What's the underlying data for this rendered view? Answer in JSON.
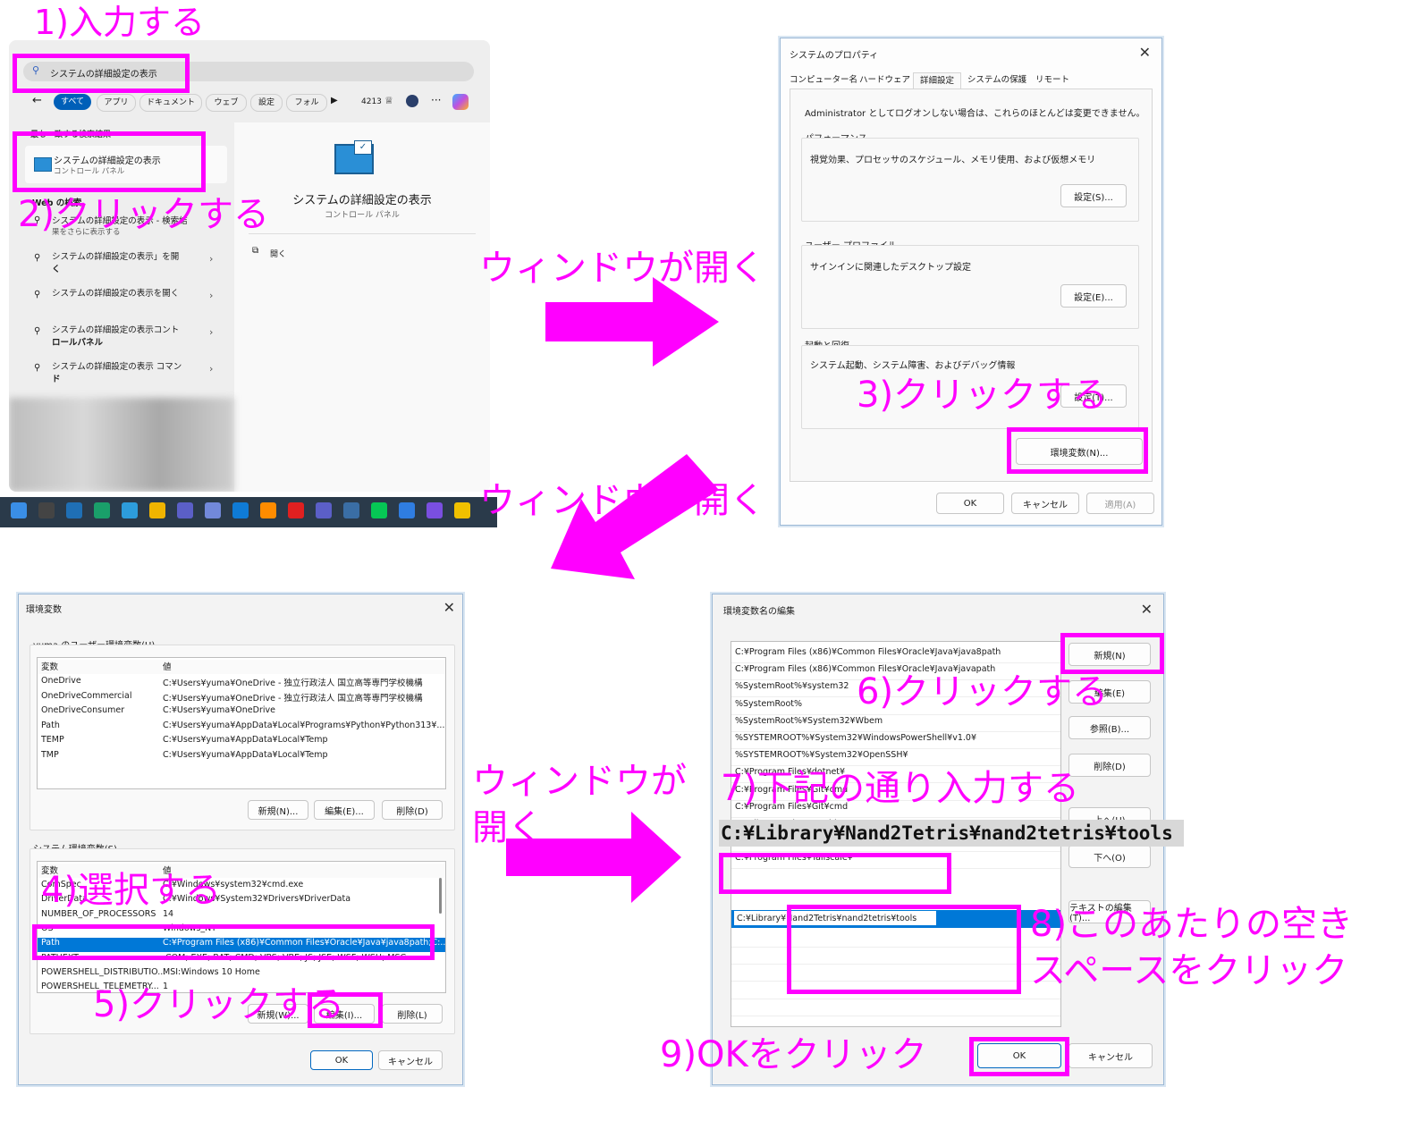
{
  "annotations": {
    "step1": "1)入力する",
    "step2": "2)クリックする",
    "step3": "3)クリックする",
    "step4": "4)選択する",
    "step5": "5)クリックする",
    "step6": "6)クリックする",
    "step7": "7)下記の通り入力する",
    "step8_line1": "8)このあたりの空き",
    "step8_line2": "スペースをクリック",
    "step9": "9)OKをクリック",
    "window_opens": "ウィンドウが開く",
    "window_opens_a": "ウィンドウが",
    "window_opens_b": "開く",
    "path_value": "C:¥Library¥Nand2Tetris¥nand2tetris¥tools"
  },
  "search_panel": {
    "query": "システムの詳細設定の表示",
    "filters": [
      "すべて",
      "アプリ",
      "ドキュメント",
      "ウェブ",
      "設定",
      "フォル"
    ],
    "points": "4213",
    "best_match_header": "最も一致する検索結果",
    "best_match_title": "システムの詳細設定の表示",
    "best_match_sub": "コントロール パネル",
    "web_header": "Web の検索",
    "web_item1": "システムの詳細設定の表示 - 検索結",
    "web_item1_sub": "果をさらに表示する",
    "web_items": [
      {
        "a": "システムの詳細設定の表示」を開",
        "b": "く"
      },
      {
        "a": "システムの詳細設定の表示を開く",
        "b": ""
      },
      {
        "a": "システムの詳細設定の表示コント",
        "b": "ロールパネル"
      },
      {
        "a": "システムの詳細設定の表示 コマン",
        "b": "ド"
      }
    ],
    "preview_title": "システムの詳細設定の表示",
    "preview_sub": "コントロール パネル",
    "open_label": "開く"
  },
  "sysprops": {
    "title": "システムのプロパティ",
    "tabs": [
      "コンピューター名",
      "ハードウェア",
      "詳細設定",
      "システムの保護",
      "リモート"
    ],
    "admin_note": "Administrator としてログオンしない場合は、これらのほとんどは変更できません。",
    "perf_title": "パフォーマンス",
    "perf_desc": "視覚効果、プロセッサのスケジュール、メモリ使用、および仮想メモリ",
    "perf_btn": "設定(S)...",
    "profile_title": "ユーザー プロファイル",
    "profile_desc": "サインインに関連したデスクトップ設定",
    "profile_btn": "設定(E)...",
    "startup_title": "起動と回復",
    "startup_desc": "システム起動、システム障害、およびデバッグ情報",
    "startup_btn": "設定(T)...",
    "env_btn": "環境変数(N)...",
    "ok": "OK",
    "cancel": "キャンセル",
    "apply": "適用(A)"
  },
  "envvars": {
    "title": "環境変数",
    "user_header": "yuma のユーザー環境変数(U)",
    "col_var": "変数",
    "col_val": "値",
    "user_rows": [
      {
        "n": "OneDrive",
        "v": "C:¥Users¥yuma¥OneDrive - 独立行政法人 国立高等専門学校機構"
      },
      {
        "n": "OneDriveCommercial",
        "v": "C:¥Users¥yuma¥OneDrive - 独立行政法人 国立高等専門学校機構"
      },
      {
        "n": "OneDriveConsumer",
        "v": "C:¥Users¥yuma¥OneDrive"
      },
      {
        "n": "Path",
        "v": "C:¥Users¥yuma¥AppData¥Local¥Programs¥Python¥Python313¥..."
      },
      {
        "n": "TEMP",
        "v": "C:¥Users¥yuma¥AppData¥Local¥Temp"
      },
      {
        "n": "TMP",
        "v": "C:¥Users¥yuma¥AppData¥Local¥Temp"
      }
    ],
    "user_new": "新規(N)...",
    "user_edit": "編集(E)...",
    "user_del": "削除(D)",
    "sys_header": "システム環境変数(S)",
    "sys_rows": [
      {
        "n": "ComSpec",
        "v": "C:¥Windows¥system32¥cmd.exe"
      },
      {
        "n": "DriverData",
        "v": "C:¥Windows¥System32¥Drivers¥DriverData"
      },
      {
        "n": "NUMBER_OF_PROCESSORS",
        "v": "14"
      },
      {
        "n": "OS",
        "v": "Windows_NT"
      },
      {
        "n": "Path",
        "v": "C:¥Program Files (x86)¥Common Files¥Oracle¥Java¥java8path;C:..."
      },
      {
        "n": "PATHEXT",
        "v": ".COM;.EXE;.BAT;.CMD;.VBS;.VBE;.JS;.JSE;.WSF;.WSH;.MSC"
      },
      {
        "n": "POWERSHELL_DISTRIBUTIO...",
        "v": "MSI:Windows 10 Home"
      },
      {
        "n": "POWERSHELL_TELEMETRY...",
        "v": "1"
      }
    ],
    "sys_new": "新規(W)...",
    "sys_edit": "編集(I)...",
    "sys_del": "削除(L)",
    "ok": "OK",
    "cancel": "キャンセル"
  },
  "editenv": {
    "title": "環境変数名の編集",
    "items": [
      "C:¥Program Files (x86)¥Common Files¥Oracle¥Java¥java8path",
      "C:¥Program Files (x86)¥Common Files¥Oracle¥Java¥javapath",
      "%SystemRoot%¥system32",
      "%SystemRoot%",
      "%SystemRoot%¥System32¥Wbem",
      "%SYSTEMROOT%¥System32¥WindowsPowerShell¥v1.0¥",
      "%SYSTEMROOT%¥System32¥OpenSSH¥",
      "C:¥Program Files¥dotnet¥",
      "C:¥Program Files¥Git¥cmd",
      "C:¥Program Files¥Git¥cmd",
      "C:¥Library¥mingw64¥bin",
      "C:¥Program Files¥",
      "C:¥Program Files¥Tailscale¥"
    ],
    "edit_value": "C:¥Library¥Nand2Tetris¥nand2tetris¥tools",
    "btn_new": "新規(N)",
    "btn_edit": "編集(E)",
    "btn_browse": "参照(B)...",
    "btn_del": "削除(D)",
    "btn_up": "上へ(U)",
    "btn_down": "下へ(O)",
    "btn_text": "テキストの編集(T)...",
    "ok": "OK",
    "cancel": "キャンセル"
  },
  "colors": {
    "annotation": "#ff00ff",
    "selection": "#0078d7"
  }
}
